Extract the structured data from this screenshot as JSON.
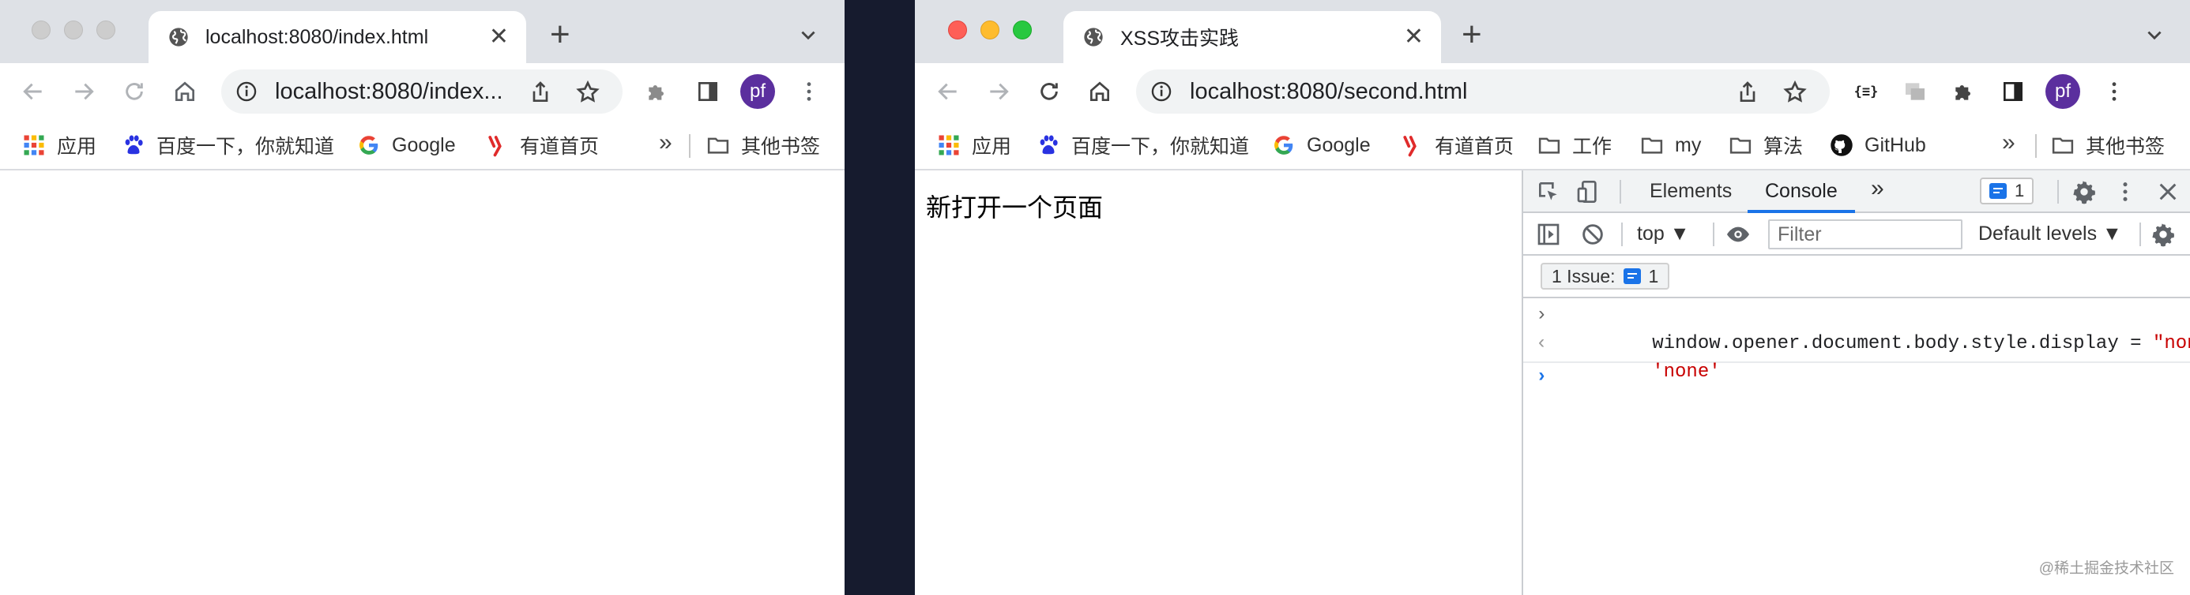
{
  "left_window": {
    "tab": {
      "title": "localhost:8080/index.html",
      "close": "✕"
    },
    "new_tab": "+",
    "url": "localhost:8080/index...",
    "avatar": "pf",
    "bookmarks": [
      {
        "label": "应用",
        "icon": "apps-grid-icon"
      },
      {
        "label": "百度一下，你就知道",
        "icon": "baidu-paw-icon"
      },
      {
        "label": "Google",
        "icon": "google-g-icon"
      },
      {
        "label": "有道首页",
        "icon": "youdao-icon"
      }
    ],
    "more": "»",
    "other_bookmarks": "其他书签"
  },
  "right_window": {
    "tab": {
      "title": "XSS攻击实践",
      "close": "✕"
    },
    "new_tab": "+",
    "url": "localhost:8080/second.html",
    "avatar": "pf",
    "bookmarks": [
      {
        "label": "应用",
        "icon": "apps-grid-icon"
      },
      {
        "label": "百度一下，你就知道",
        "icon": "baidu-paw-icon"
      },
      {
        "label": "Google",
        "icon": "google-g-icon"
      },
      {
        "label": "有道首页",
        "icon": "youdao-icon"
      },
      {
        "label": "工作",
        "icon": "folder-icon"
      },
      {
        "label": "my",
        "icon": "folder-icon"
      },
      {
        "label": "算法",
        "icon": "folder-icon"
      },
      {
        "label": "GitHub",
        "icon": "github-icon"
      }
    ],
    "more": "»",
    "other_bookmarks": "其他书签",
    "page_heading": "新打开一个页面"
  },
  "devtools": {
    "tabs": [
      "Elements",
      "Console"
    ],
    "active_tab": "Console",
    "more_tabs": "»",
    "issues_badge_count": "1",
    "context": "top ▼",
    "filter_placeholder": "Filter",
    "levels": "Default levels ▼",
    "issues_label": "1 Issue:",
    "issues_count": "1",
    "console": {
      "input_code": "window.opener.document.body.style.display",
      "input_operator": " = ",
      "input_string": "\"none\"",
      "result": "'none'",
      "input_chevron": "›",
      "result_chevron": "‹",
      "prompt_chevron": "›"
    }
  },
  "watermark": "@稀土掘金技术社区",
  "colors": {
    "accent": "#1a73e8",
    "avatar": "#5b2f9e",
    "string": "#c80000"
  }
}
